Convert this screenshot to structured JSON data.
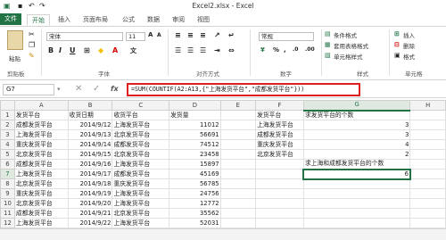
{
  "titlebar": {
    "title": "Excel2.xlsx - Excel"
  },
  "tabs": [
    "文件",
    "开始",
    "插入",
    "页面布局",
    "公式",
    "数据",
    "审阅",
    "视图"
  ],
  "ribbon": {
    "paste_label": "粘贴",
    "clipboard_label": "剪贴板",
    "font_name": "宋体",
    "font_size": "11",
    "font_group_label": "字体",
    "align_group_label": "对齐方式",
    "number_format": "常规",
    "number_group_label": "数字",
    "conditional_format": "条件格式",
    "table_format": "套用表格格式",
    "cell_style": "单元格样式",
    "style_group_label": "样式",
    "insert": "插入",
    "delete": "删除",
    "format": "格式",
    "cells_group_label": "单元格"
  },
  "formula_bar": {
    "name_box": "G7",
    "fx": "fx",
    "formula": "=SUM(COUNTIF(A2:A13,{\"上海发货平台\",\"成都发货平台\"}))"
  },
  "columns": [
    "A",
    "B",
    "C",
    "D",
    "E",
    "F",
    "G",
    "H"
  ],
  "rows": [
    [
      "发货平台",
      "收货日期",
      "收货平台",
      "发货量",
      "",
      "发货平台",
      "求发货平台的个数",
      ""
    ],
    [
      "成都发货平台",
      "2014/9/12",
      "上海发货平台",
      "11012",
      "",
      "上海发货平台",
      "3",
      ""
    ],
    [
      "上海发货平台",
      "2014/9/13",
      "北京发货平台",
      "56691",
      "",
      "成都发货平台",
      "3",
      ""
    ],
    [
      "重庆发货平台",
      "2014/9/14",
      "成都发货平台",
      "74512",
      "",
      "重庆发货平台",
      "4",
      ""
    ],
    [
      "北京发货平台",
      "2014/9/15",
      "北京发货平台",
      "23458",
      "",
      "北京发货平台",
      "2",
      ""
    ],
    [
      "成都发货平台",
      "2014/9/16",
      "上海发货平台",
      "15897",
      "",
      "",
      "求上海和成都发货平台的个数",
      ""
    ],
    [
      "上海发货平台",
      "2014/9/17",
      "成都发货平台",
      "45169",
      "",
      "",
      "6",
      ""
    ],
    [
      "北京发货平台",
      "2014/9/18",
      "重庆发货平台",
      "56785",
      "",
      "",
      "",
      ""
    ],
    [
      "重庆发货平台",
      "2014/9/19",
      "上海发货平台",
      "24756",
      "",
      "",
      "",
      ""
    ],
    [
      "北京发货平台",
      "2014/9/20",
      "上海发货平台",
      "12772",
      "",
      "",
      "",
      ""
    ],
    [
      "成都发货平台",
      "2014/9/21",
      "北京发货平台",
      "35562",
      "",
      "",
      "",
      ""
    ],
    [
      "上海发货平台",
      "2014/9/22",
      "上海发货平台",
      "52031",
      "",
      "",
      "",
      ""
    ],
    [
      "重庆发货平台",
      "2014/9/23",
      "北京发货平台",
      "12506",
      "",
      "",
      "",
      ""
    ]
  ],
  "accent": "#217346",
  "highlight": "#e02020"
}
